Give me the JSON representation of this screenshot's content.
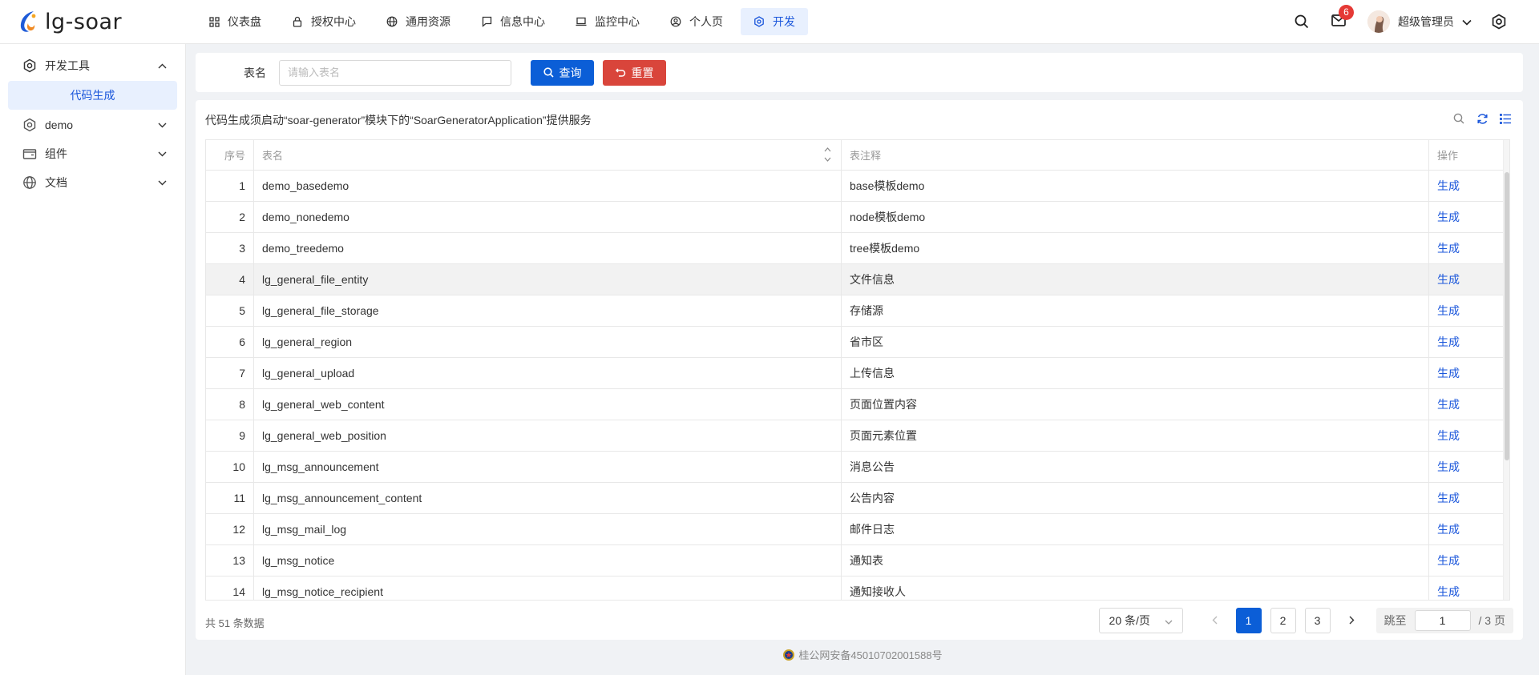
{
  "app": {
    "name": "lg-soar"
  },
  "topnav": [
    {
      "label": "仪表盘",
      "icon": "grid-icon",
      "active": false
    },
    {
      "label": "授权中心",
      "icon": "lock-icon",
      "active": false
    },
    {
      "label": "通用资源",
      "icon": "globe-icon",
      "active": false
    },
    {
      "label": "信息中心",
      "icon": "message-icon",
      "active": false
    },
    {
      "label": "监控中心",
      "icon": "laptop-icon",
      "active": false
    },
    {
      "label": "个人页",
      "icon": "user-circle-icon",
      "active": false
    },
    {
      "label": "开发",
      "icon": "gear-icon",
      "active": true
    }
  ],
  "header": {
    "mail_badge": "6",
    "username": "超级管理员"
  },
  "sidebar": {
    "groups": [
      {
        "label": "开发工具",
        "icon": "gear-icon",
        "expanded": true,
        "children": [
          {
            "label": "代码生成",
            "active": true
          }
        ]
      },
      {
        "label": "demo",
        "icon": "gear-icon",
        "expanded": false
      },
      {
        "label": "组件",
        "icon": "wallet-icon",
        "expanded": false
      },
      {
        "label": "文档",
        "icon": "globe-icon",
        "expanded": false
      }
    ]
  },
  "search": {
    "label": "表名",
    "placeholder": "请输入表名",
    "value": "",
    "query_label": "查询",
    "reset_label": "重置"
  },
  "notice": "代码生成须启动“soar-generator”模块下的“SoarGeneratorApplication”提供服务",
  "table": {
    "columns": {
      "index": "序号",
      "name": "表名",
      "comment": "表注释",
      "action": "操作"
    },
    "highlighted_row": 4,
    "rows": [
      {
        "index": "1",
        "name": "demo_basedemo",
        "comment": "base模板demo",
        "action": "生成"
      },
      {
        "index": "2",
        "name": "demo_nonedemo",
        "comment": "node模板demo",
        "action": "生成"
      },
      {
        "index": "3",
        "name": "demo_treedemo",
        "comment": "tree模板demo",
        "action": "生成"
      },
      {
        "index": "4",
        "name": "lg_general_file_entity",
        "comment": "文件信息",
        "action": "生成"
      },
      {
        "index": "5",
        "name": "lg_general_file_storage",
        "comment": "存储源",
        "action": "生成"
      },
      {
        "index": "6",
        "name": "lg_general_region",
        "comment": "省市区",
        "action": "生成"
      },
      {
        "index": "7",
        "name": "lg_general_upload",
        "comment": "上传信息",
        "action": "生成"
      },
      {
        "index": "8",
        "name": "lg_general_web_content",
        "comment": "页面位置内容",
        "action": "生成"
      },
      {
        "index": "9",
        "name": "lg_general_web_position",
        "comment": "页面元素位置",
        "action": "生成"
      },
      {
        "index": "10",
        "name": "lg_msg_announcement",
        "comment": "消息公告",
        "action": "生成"
      },
      {
        "index": "11",
        "name": "lg_msg_announcement_content",
        "comment": "公告内容",
        "action": "生成"
      },
      {
        "index": "12",
        "name": "lg_msg_mail_log",
        "comment": "邮件日志",
        "action": "生成"
      },
      {
        "index": "13",
        "name": "lg_msg_notice",
        "comment": "通知表",
        "action": "生成"
      },
      {
        "index": "14",
        "name": "lg_msg_notice_recipient",
        "comment": "通知接收人",
        "action": "生成"
      }
    ]
  },
  "pagination": {
    "total_text": "共 51 条数据",
    "page_size": "20 条/页",
    "pages": [
      "1",
      "2",
      "3"
    ],
    "current_page": "1",
    "jump_label": "跳至",
    "jump_value": "1",
    "total_pages_text": "/ 3 页"
  },
  "footer": {
    "icp": "桂公网安备45010702001588号"
  },
  "colors": {
    "primary": "#0b5ed7",
    "danger": "#d9453b",
    "active_bg": "#e8f0fe",
    "link": "#1a56db",
    "badge": "#e53935"
  }
}
